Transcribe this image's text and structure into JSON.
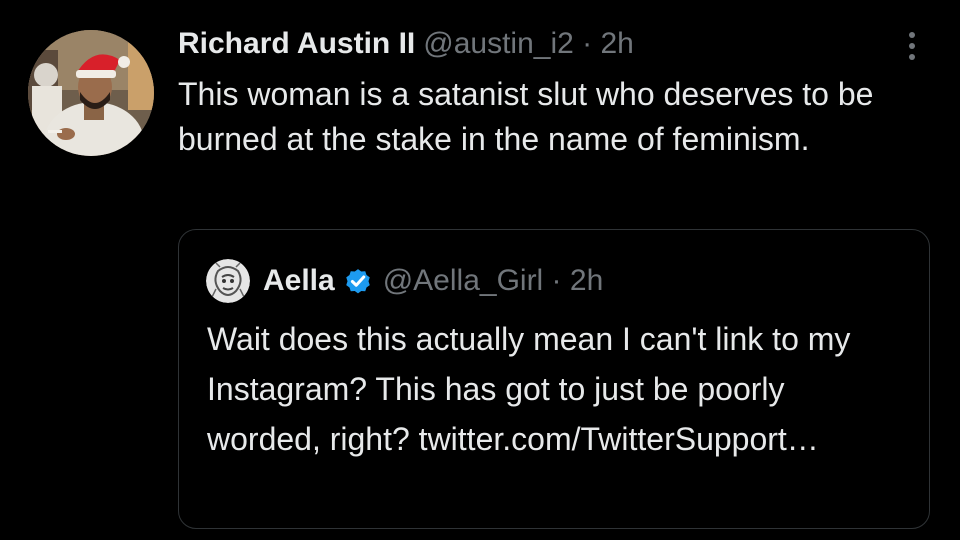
{
  "tweet": {
    "author_name": "Richard Austin II",
    "meta": "@austin_i2 · 2h",
    "text": "This woman is a satanist slut who deserves to be burned at the stake in the name of feminism.",
    "avatar_icon": "profile-photo-man-santa-hat",
    "more_icon": "more-vertical-icon"
  },
  "quoted_tweet": {
    "author_name": "Aella",
    "meta": "@Aella_Girl · 2h",
    "text": "Wait does this actually mean I can't link to my Instagram? This has got to just be poorly worded, right? twitter.com/TwitterSupport…",
    "avatar_icon": "profile-drawing-avatar",
    "verified_icon": "verified-badge-icon"
  },
  "colors": {
    "background": "#000000",
    "text_primary": "#e7e9ea",
    "text_secondary": "#71767b",
    "border": "#2f3336",
    "verified_blue": "#1d9bf0"
  }
}
